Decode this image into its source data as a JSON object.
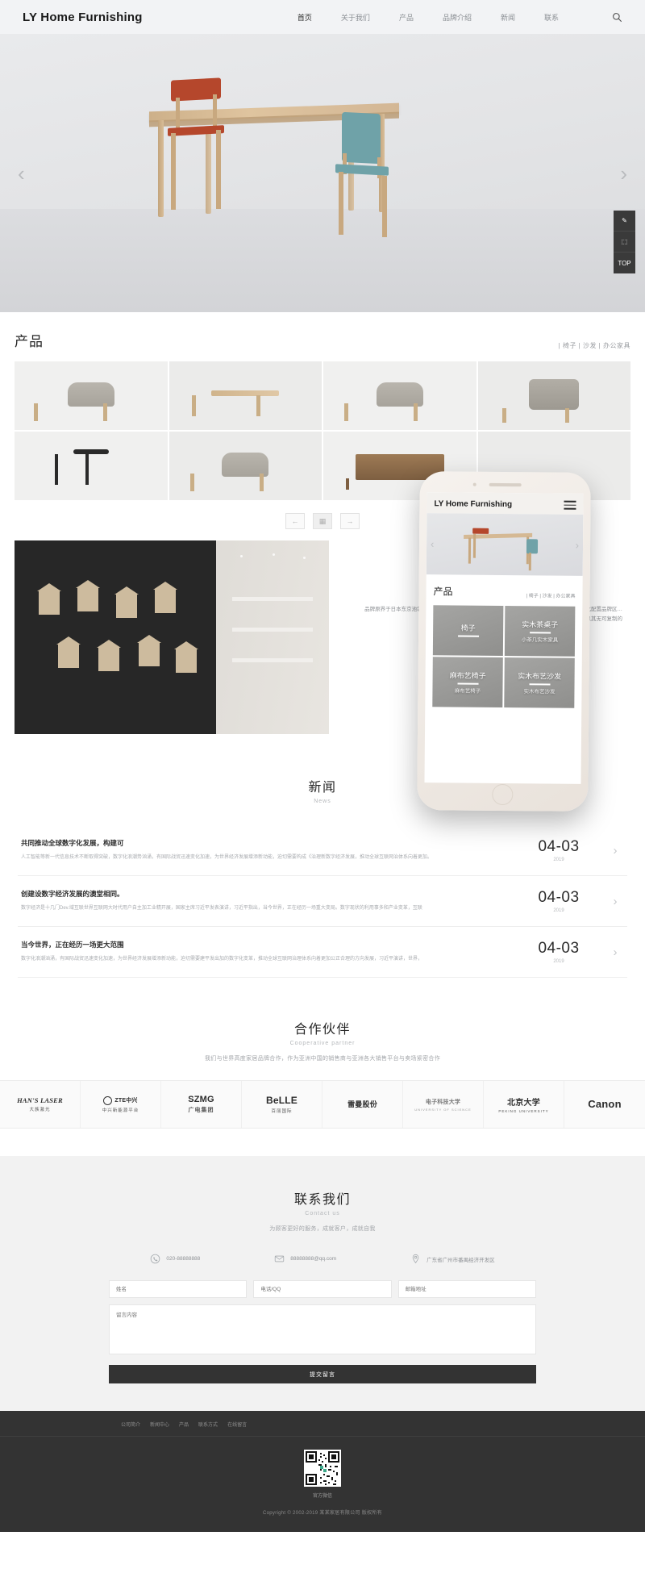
{
  "site": {
    "logo": "LY Home Furnishing"
  },
  "header": {
    "nav": [
      {
        "label": "首页",
        "active": true
      },
      {
        "label": "关于我们",
        "active": false
      },
      {
        "label": "产品",
        "active": false
      },
      {
        "label": "品牌介绍",
        "active": false
      },
      {
        "label": "新闻",
        "active": false
      },
      {
        "label": "联系",
        "active": false
      }
    ],
    "search_icon": "search-icon"
  },
  "hero": {
    "prev_arrow": "‹",
    "next_arrow": "›"
  },
  "sidetools": [
    {
      "icon": "chat-icon",
      "label": "✎"
    },
    {
      "icon": "qrcode-icon",
      "label": "⬚"
    },
    {
      "icon": "top-icon",
      "label": "TOP"
    }
  ],
  "products": {
    "title": "产品",
    "categories": "| 椅子 | 沙发 | 办公家具",
    "items": [
      {
        "name": "stool-gray",
        "shape": "stool"
      },
      {
        "name": "bench-wood",
        "shape": "bench"
      },
      {
        "name": "stool-gray-2",
        "shape": "stool"
      },
      {
        "name": "armchair-gray",
        "shape": "armchair"
      },
      {
        "name": "chair-black",
        "shape": "blackchair"
      },
      {
        "name": "stool-gray-3",
        "shape": "stool"
      },
      {
        "name": "cabinet-wood",
        "shape": "cabinet"
      },
      {
        "name": "empty",
        "shape": "none"
      }
    ],
    "pager": {
      "prev": "←",
      "grid": "▦",
      "next": "→"
    }
  },
  "showroom": {
    "text": "品牌原界于日本东京池袋，城米 东京·米·广·大·好·用·创·作·品牌。\n牌店面上，对室极场单的多样化配置品牌区…\nHarbor House以其无可复制的"
  },
  "phone": {
    "logo": "LY Home Furnishing",
    "menu_icon": "hamburger-icon",
    "prev_arrow": "‹",
    "next_arrow": "›",
    "section_title": "产品",
    "categories": "| 椅子 | 沙发 | 办公家具",
    "tiles": [
      {
        "title": "椅子",
        "subtitle": ""
      },
      {
        "title": "实木茶桌子",
        "subtitle": "小茶几实木家具"
      },
      {
        "title": "麻布艺椅子",
        "subtitle": "麻布艺椅子"
      },
      {
        "title": "实木布艺沙发",
        "subtitle": "实木布艺沙发"
      }
    ]
  },
  "news": {
    "title": "新闻",
    "subtitle": "News",
    "items": [
      {
        "title": "共同推动全球数字化发展，构建可",
        "desc": "人工智能等新一代信息技术不断取得突破，数字化浪潮势汹涌，有国际战贸迅速变化加速，为世界经济发展增添新动能，迫切需要构成《治理新数字经济发展，推动全球互联网治体系向着更加。",
        "date": "04-03",
        "year": "2019",
        "chevron": "›"
      },
      {
        "title": "创建设数字经济发展的澳堂相同。",
        "desc": "数字经济是十几门Dev.域互联世界互联网大时代用户自主加工业精开展，国家主席习近平发表演讲，习近平指出，当今世界，正在经历一场重大变局。数字现状的利用事多和产业变革，互联",
        "date": "04-03",
        "year": "2019",
        "chevron": "›"
      },
      {
        "title": "当今世界，正在经历一场更大范围",
        "desc": "数字化浪潮汹涌，有国际战贸迅速变化加速，为世界经济发展增添新动能，迫切需要建平发出加的数字化变革，推动全球互联网治理体系向着更加公正合理的方向发展，习近平演讲，世界，",
        "date": "04-03",
        "year": "2019",
        "chevron": "›"
      }
    ]
  },
  "partners": {
    "title": "合作伙伴",
    "subtitle": "Cooperative partner",
    "desc": "我们与世界高度家居品牌合作，作为亚洲中国的销售商与亚洲各大销售平台与卖场紧密合作",
    "logos": [
      {
        "main": "HAN'S LASER",
        "sub": "大族激光",
        "style": "serif"
      },
      {
        "main": "ZTE中兴",
        "sub": "中兴新能源平台",
        "style": "plain"
      },
      {
        "main": "SZMG",
        "sub": "广电集团",
        "style": "plain"
      },
      {
        "main": "BeLLE",
        "sub": "百丽国际",
        "style": "plain"
      },
      {
        "main": "雷曼股份",
        "sub": "",
        "style": "plain"
      },
      {
        "main": "电子科技大学",
        "sub": "UNIVERSITY OF SCIENCE",
        "style": "plain"
      },
      {
        "main": "北京大学",
        "sub": "PEKING UNIVERSITY",
        "style": "plain"
      },
      {
        "main": "Canon",
        "sub": "",
        "style": "plain"
      }
    ]
  },
  "contact": {
    "title": "联系我们",
    "subtitle": "Contact us",
    "desc": "为顾客更好的服务，成就客户，成就自我",
    "info": [
      {
        "icon": "phone-icon",
        "value": "020-88888888"
      },
      {
        "icon": "mail-icon",
        "value": "88888888@qq.com"
      },
      {
        "icon": "location-icon",
        "value": "广东省广州市番禺经济开发区"
      }
    ],
    "form": {
      "name_placeholder": "姓名",
      "phone_placeholder": "电话/QQ",
      "email_placeholder": "邮箱地址",
      "message_placeholder": "留言内容",
      "submit_label": "提交留言"
    }
  },
  "footer": {
    "nav": [
      "公司简介",
      "新闻中心",
      "产品",
      "联系方式",
      "在线留言"
    ],
    "qr_label": "官方微信",
    "copyright": "Copyright © 2002-2019 某某家居有限公司 版权所有"
  }
}
